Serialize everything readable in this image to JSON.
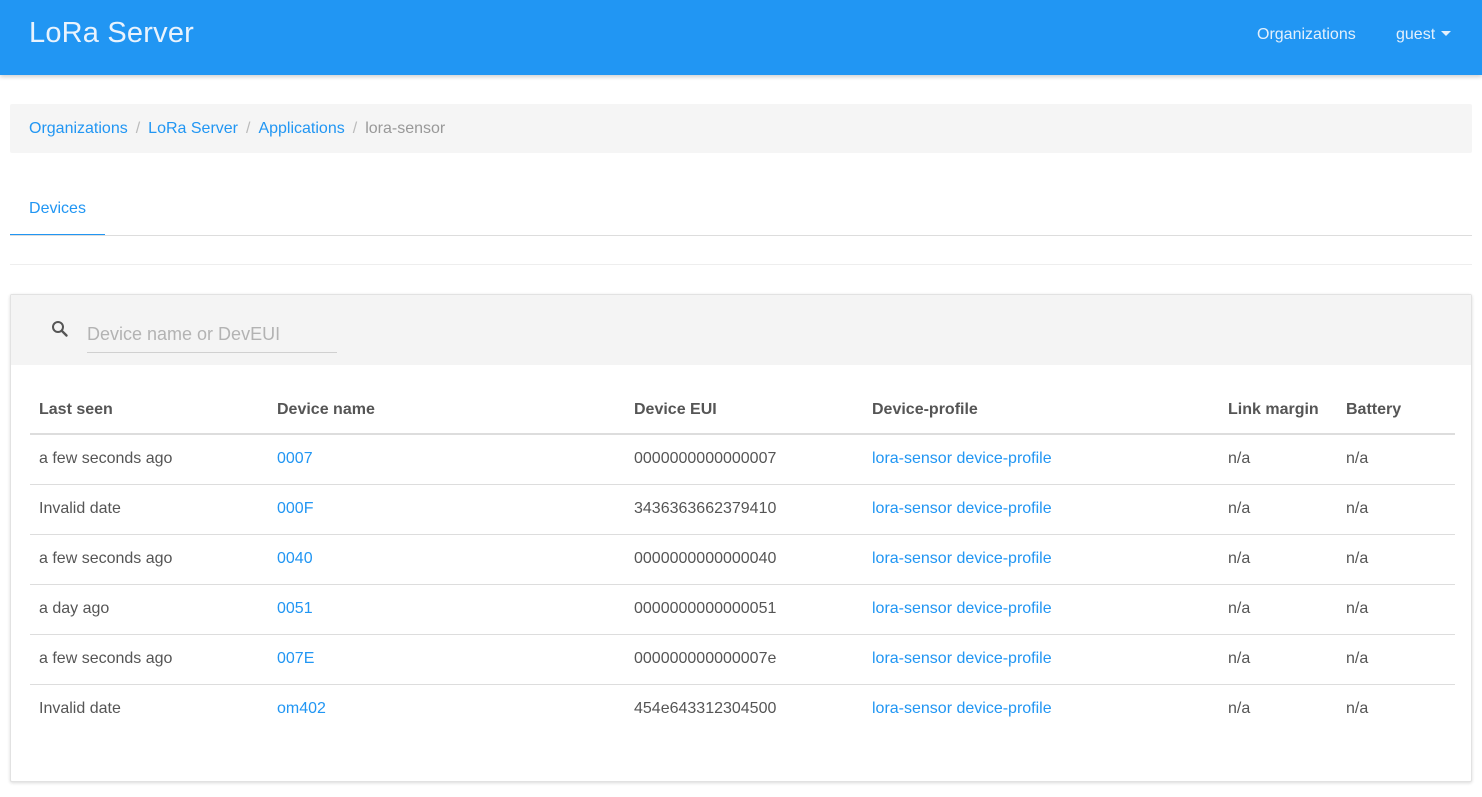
{
  "navbar": {
    "brand": "LoRa Server",
    "organizations_label": "Organizations",
    "user_label": "guest"
  },
  "breadcrumb": {
    "items": [
      "Organizations",
      "LoRa Server",
      "Applications"
    ],
    "active": "lora-sensor",
    "separator": "/"
  },
  "tabs": [
    {
      "label": "Devices",
      "active": true
    }
  ],
  "search": {
    "placeholder": "Device name or DevEUI",
    "value": ""
  },
  "table": {
    "headers": [
      "Last seen",
      "Device name",
      "Device EUI",
      "Device-profile",
      "Link margin",
      "Battery"
    ],
    "rows": [
      {
        "last_seen": "a few seconds ago",
        "name": "0007",
        "eui": "0000000000000007",
        "profile": "lora-sensor device-profile",
        "link_margin": "n/a",
        "battery": "n/a"
      },
      {
        "last_seen": "Invalid date",
        "name": "000F",
        "eui": "3436363662379410",
        "profile": "lora-sensor device-profile",
        "link_margin": "n/a",
        "battery": "n/a"
      },
      {
        "last_seen": "a few seconds ago",
        "name": "0040",
        "eui": "0000000000000040",
        "profile": "lora-sensor device-profile",
        "link_margin": "n/a",
        "battery": "n/a"
      },
      {
        "last_seen": "a day ago",
        "name": "0051",
        "eui": "0000000000000051",
        "profile": "lora-sensor device-profile",
        "link_margin": "n/a",
        "battery": "n/a"
      },
      {
        "last_seen": "a few seconds ago",
        "name": "007E",
        "eui": "000000000000007e",
        "profile": "lora-sensor device-profile",
        "link_margin": "n/a",
        "battery": "n/a"
      },
      {
        "last_seen": "Invalid date",
        "name": "om402",
        "eui": "454e643312304500",
        "profile": "lora-sensor device-profile",
        "link_margin": "n/a",
        "battery": "n/a"
      }
    ]
  },
  "colors": {
    "primary": "#2196f3",
    "text": "#555555"
  },
  "icons": {
    "search": "search-icon",
    "caret": "caret-down-icon"
  }
}
